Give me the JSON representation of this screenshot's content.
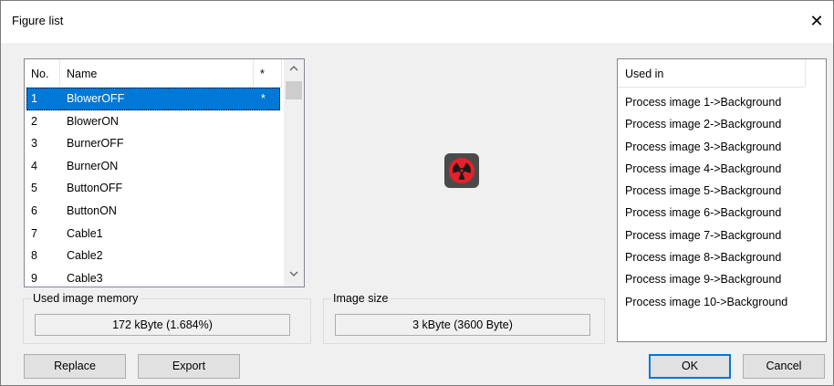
{
  "window": {
    "title": "Figure list",
    "close_glyph": "✕"
  },
  "figure_table": {
    "columns": [
      "No.",
      "Name",
      "*"
    ],
    "rows": [
      {
        "no": "1",
        "name": "BlowerOFF",
        "star": "*",
        "selected": true
      },
      {
        "no": "2",
        "name": "BlowerON",
        "star": ""
      },
      {
        "no": "3",
        "name": "BurnerOFF",
        "star": ""
      },
      {
        "no": "4",
        "name": "BurnerON",
        "star": ""
      },
      {
        "no": "5",
        "name": "ButtonOFF",
        "star": ""
      },
      {
        "no": "6",
        "name": "ButtonON",
        "star": ""
      },
      {
        "no": "7",
        "name": "Cable1",
        "star": ""
      },
      {
        "no": "8",
        "name": "Cable2",
        "star": ""
      },
      {
        "no": "9",
        "name": "Cable3",
        "star": ""
      }
    ],
    "scroll_up": "^",
    "scroll_down": "v"
  },
  "used_memory": {
    "label": "Used image memory",
    "value": "172 kByte (1.684%)"
  },
  "image_size": {
    "label": "Image size",
    "value": "3 kByte (3600 Byte)"
  },
  "preview": {
    "icon": "blower-off-icon",
    "colors": {
      "body": "#4a4a4a",
      "fan": "#e8202a"
    }
  },
  "used_in": {
    "header": "Used in",
    "items": [
      "Process image 1->Background",
      "Process image 2->Background",
      "Process image 3->Background",
      "Process image 4->Background",
      "Process image 5->Background",
      "Process image 6->Background",
      "Process image 7->Background",
      "Process image 8->Background",
      "Process image 9->Background",
      "Process image 10->Background"
    ]
  },
  "buttons": {
    "replace": "Replace",
    "export": "Export",
    "ok": "OK",
    "cancel": "Cancel"
  }
}
